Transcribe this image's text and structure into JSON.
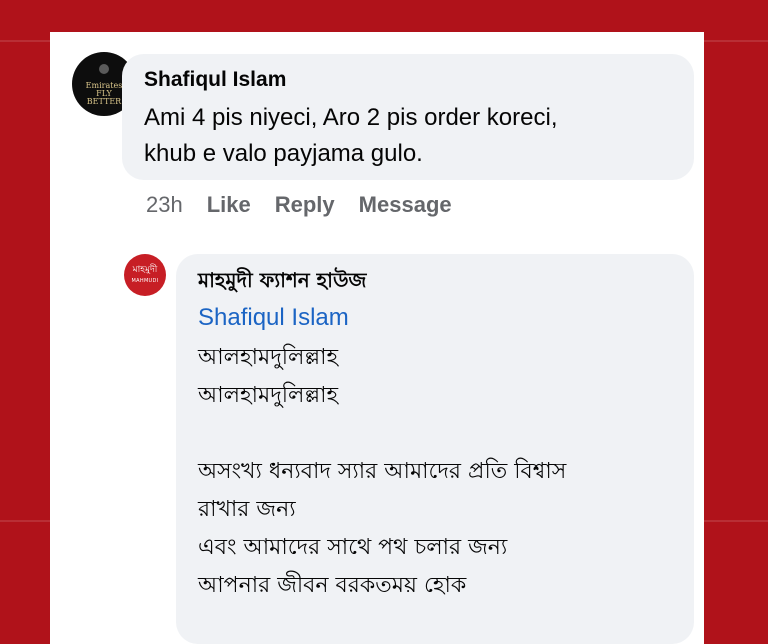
{
  "comment": {
    "author": "Shafiqul Islam",
    "avatar_text": "Emirates FLY BETTER",
    "text_line1": "Ami 4 pis niyeci,  Aro 2 pis order koreci,",
    "text_line2": "khub e valo payjama gulo."
  },
  "actions": {
    "time": "23h",
    "like": "Like",
    "reply": "Reply",
    "message": "Message"
  },
  "reply": {
    "author": "মাহমুদী ফ্যাশন হাউজ",
    "avatar_text_top": "মাহমুদী",
    "avatar_text_bottom": "MAHMUDI",
    "mention": "Shafiqul Islam",
    "lines": [
      "আলহামদুলিল্লাহ",
      "আলহামদুলিল্লাহ",
      "অসংখ্য ধন্যবাদ স্যার আমাদের প্রতি বিশ্বাস",
      "রাখার জন্য",
      "এবং আমাদের সাথে পথ চলার জন্য",
      "আপনার জীবন বরকতময় হোক"
    ]
  },
  "colors": {
    "background": "#b0121a",
    "bubble": "#f0f2f5",
    "link": "#1b64c4",
    "muted": "#65676b"
  }
}
